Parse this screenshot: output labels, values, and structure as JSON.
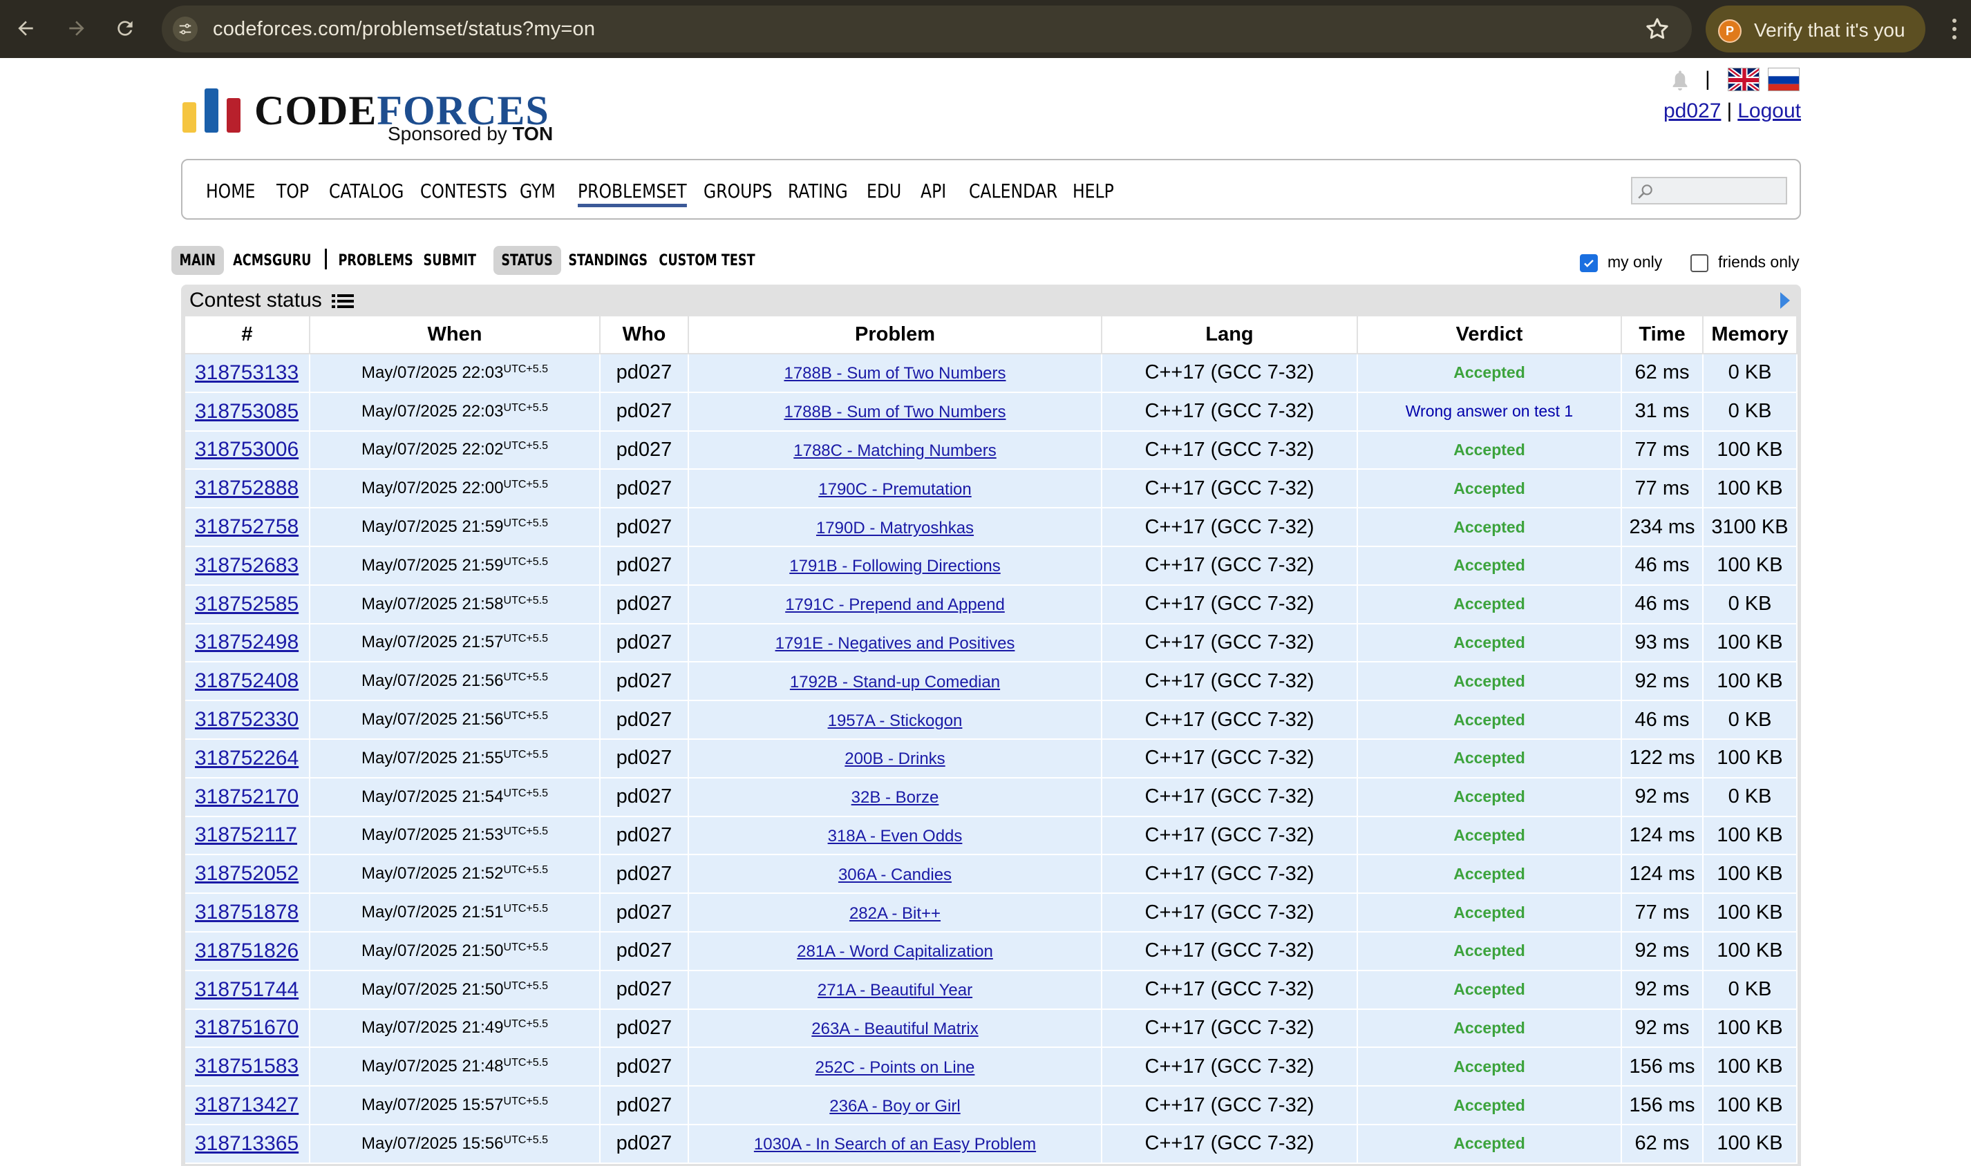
{
  "browser": {
    "url": "codeforces.com/problemset/status?my=on",
    "verify_label": "Verify that it's you",
    "avatar_letter": "P"
  },
  "header": {
    "logo_code": "CODE",
    "logo_forces": "FORCES",
    "sponsor_prefix": "Sponsored by ",
    "sponsor_name": "TON",
    "separator": "|",
    "username": "pd027",
    "logout": "Logout",
    "link_separator": "|"
  },
  "main_menu": {
    "items": [
      "HOME",
      "TOP",
      "CATALOG",
      "CONTESTS",
      "GYM",
      "PROBLEMSET",
      "GROUPS",
      "RATING",
      "EDU",
      "API",
      "CALENDAR",
      "HELP"
    ],
    "active": "PROBLEMSET"
  },
  "second_menu": {
    "items": [
      "MAIN",
      "ACMSGURU",
      "PROBLEMS",
      "SUBMIT",
      "STATUS",
      "STANDINGS",
      "CUSTOM TEST"
    ],
    "active": [
      "MAIN",
      "STATUS"
    ]
  },
  "filters": {
    "my_only": {
      "label": "my only",
      "checked": true
    },
    "friends_only": {
      "label": "friends only",
      "checked": false
    }
  },
  "panel": {
    "title": "Contest status"
  },
  "table": {
    "columns": [
      "#",
      "When",
      "Who",
      "Problem",
      "Lang",
      "Verdict",
      "Time",
      "Memory"
    ],
    "timezone_sup": "UTC+5.5",
    "rows": [
      {
        "id": "318753133",
        "when": "May/07/2025 22:03",
        "who": "pd027",
        "problem": "1788B - Sum of Two Numbers",
        "lang": "C++17 (GCC 7-32)",
        "verdict": "Accepted",
        "time": "62 ms",
        "memory": "0 KB"
      },
      {
        "id": "318753085",
        "when": "May/07/2025 22:03",
        "who": "pd027",
        "problem": "1788B - Sum of Two Numbers",
        "lang": "C++17 (GCC 7-32)",
        "verdict": "Wrong answer on test 1",
        "time": "31 ms",
        "memory": "0 KB"
      },
      {
        "id": "318753006",
        "when": "May/07/2025 22:02",
        "who": "pd027",
        "problem": "1788C - Matching Numbers",
        "lang": "C++17 (GCC 7-32)",
        "verdict": "Accepted",
        "time": "77 ms",
        "memory": "100 KB"
      },
      {
        "id": "318752888",
        "when": "May/07/2025 22:00",
        "who": "pd027",
        "problem": "1790C - Premutation",
        "lang": "C++17 (GCC 7-32)",
        "verdict": "Accepted",
        "time": "77 ms",
        "memory": "100 KB"
      },
      {
        "id": "318752758",
        "when": "May/07/2025 21:59",
        "who": "pd027",
        "problem": "1790D - Matryoshkas",
        "lang": "C++17 (GCC 7-32)",
        "verdict": "Accepted",
        "time": "234 ms",
        "memory": "3100 KB"
      },
      {
        "id": "318752683",
        "when": "May/07/2025 21:59",
        "who": "pd027",
        "problem": "1791B - Following Directions",
        "lang": "C++17 (GCC 7-32)",
        "verdict": "Accepted",
        "time": "46 ms",
        "memory": "100 KB"
      },
      {
        "id": "318752585",
        "when": "May/07/2025 21:58",
        "who": "pd027",
        "problem": "1791C - Prepend and Append",
        "lang": "C++17 (GCC 7-32)",
        "verdict": "Accepted",
        "time": "46 ms",
        "memory": "0 KB"
      },
      {
        "id": "318752498",
        "when": "May/07/2025 21:57",
        "who": "pd027",
        "problem": "1791E - Negatives and Positives",
        "lang": "C++17 (GCC 7-32)",
        "verdict": "Accepted",
        "time": "93 ms",
        "memory": "100 KB"
      },
      {
        "id": "318752408",
        "when": "May/07/2025 21:56",
        "who": "pd027",
        "problem": "1792B - Stand-up Comedian",
        "lang": "C++17 (GCC 7-32)",
        "verdict": "Accepted",
        "time": "92 ms",
        "memory": "100 KB"
      },
      {
        "id": "318752330",
        "when": "May/07/2025 21:56",
        "who": "pd027",
        "problem": "1957A - Stickogon",
        "lang": "C++17 (GCC 7-32)",
        "verdict": "Accepted",
        "time": "46 ms",
        "memory": "0 KB"
      },
      {
        "id": "318752264",
        "when": "May/07/2025 21:55",
        "who": "pd027",
        "problem": "200B - Drinks",
        "lang": "C++17 (GCC 7-32)",
        "verdict": "Accepted",
        "time": "122 ms",
        "memory": "100 KB"
      },
      {
        "id": "318752170",
        "when": "May/07/2025 21:54",
        "who": "pd027",
        "problem": "32B - Borze",
        "lang": "C++17 (GCC 7-32)",
        "verdict": "Accepted",
        "time": "92 ms",
        "memory": "0 KB"
      },
      {
        "id": "318752117",
        "when": "May/07/2025 21:53",
        "who": "pd027",
        "problem": "318A - Even Odds",
        "lang": "C++17 (GCC 7-32)",
        "verdict": "Accepted",
        "time": "124 ms",
        "memory": "100 KB"
      },
      {
        "id": "318752052",
        "when": "May/07/2025 21:52",
        "who": "pd027",
        "problem": "306A - Candies",
        "lang": "C++17 (GCC 7-32)",
        "verdict": "Accepted",
        "time": "124 ms",
        "memory": "100 KB"
      },
      {
        "id": "318751878",
        "when": "May/07/2025 21:51",
        "who": "pd027",
        "problem": "282A - Bit++",
        "lang": "C++17 (GCC 7-32)",
        "verdict": "Accepted",
        "time": "77 ms",
        "memory": "100 KB"
      },
      {
        "id": "318751826",
        "when": "May/07/2025 21:50",
        "who": "pd027",
        "problem": "281A - Word Capitalization",
        "lang": "C++17 (GCC 7-32)",
        "verdict": "Accepted",
        "time": "92 ms",
        "memory": "100 KB"
      },
      {
        "id": "318751744",
        "when": "May/07/2025 21:50",
        "who": "pd027",
        "problem": "271A - Beautiful Year",
        "lang": "C++17 (GCC 7-32)",
        "verdict": "Accepted",
        "time": "92 ms",
        "memory": "0 KB"
      },
      {
        "id": "318751670",
        "when": "May/07/2025 21:49",
        "who": "pd027",
        "problem": "263A - Beautiful Matrix",
        "lang": "C++17 (GCC 7-32)",
        "verdict": "Accepted",
        "time": "92 ms",
        "memory": "100 KB"
      },
      {
        "id": "318751583",
        "when": "May/07/2025 21:48",
        "who": "pd027",
        "problem": "252C - Points on Line",
        "lang": "C++17 (GCC 7-32)",
        "verdict": "Accepted",
        "time": "156 ms",
        "memory": "100 KB"
      },
      {
        "id": "318713427",
        "when": "May/07/2025 15:57",
        "who": "pd027",
        "problem": "236A - Boy or Girl",
        "lang": "C++17 (GCC 7-32)",
        "verdict": "Accepted",
        "time": "156 ms",
        "memory": "100 KB"
      },
      {
        "id": "318713365",
        "when": "May/07/2025 15:56",
        "who": "pd027",
        "problem": "1030A - In Search of an Easy Problem",
        "lang": "C++17 (GCC 7-32)",
        "verdict": "Accepted",
        "time": "62 ms",
        "memory": "100 KB"
      }
    ]
  },
  "colors": {
    "chrome_bg": "#2d2a22",
    "link": "#1a1aa6",
    "accepted": "#3ca33c",
    "wrong_answer": "#0000aa",
    "row_bg": "#e2eefb",
    "panel_bg": "#e1e1e1",
    "logo_yellow": "#f5c540",
    "logo_blue": "#1a5faa",
    "logo_red": "#b8202c"
  },
  "icons": [
    "back-icon",
    "forward-icon",
    "reload-icon",
    "tune-icon",
    "star-icon",
    "more-icon",
    "bell-icon",
    "uk-flag-icon",
    "ru-flag-icon",
    "search-icon",
    "list-icon",
    "arrow-right-icon"
  ]
}
